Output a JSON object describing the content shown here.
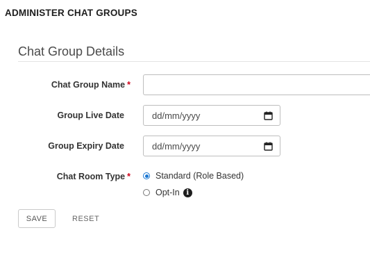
{
  "page": {
    "title": "ADMINISTER CHAT GROUPS"
  },
  "section": {
    "title": "Chat Group Details"
  },
  "fields": {
    "chat_group_name": {
      "label": "Chat Group Name",
      "required_mark": "*",
      "value": "",
      "placeholder": ""
    },
    "group_live_date": {
      "label": "Group Live Date",
      "value": "dd/mm/yyyy"
    },
    "group_expiry_date": {
      "label": "Group Expiry Date",
      "value": "dd/mm/yyyy"
    },
    "chat_room_type": {
      "label": "Chat Room Type",
      "required_mark": "*",
      "options": [
        {
          "label": "Standard (Role Based)",
          "selected": true
        },
        {
          "label": "Opt-In",
          "selected": false,
          "info_icon": "info-icon"
        }
      ]
    }
  },
  "actions": {
    "save_label": "SAVE",
    "reset_label": "RESET"
  },
  "colors": {
    "required": "#d0021b",
    "radio_selected": "#1976d2"
  }
}
